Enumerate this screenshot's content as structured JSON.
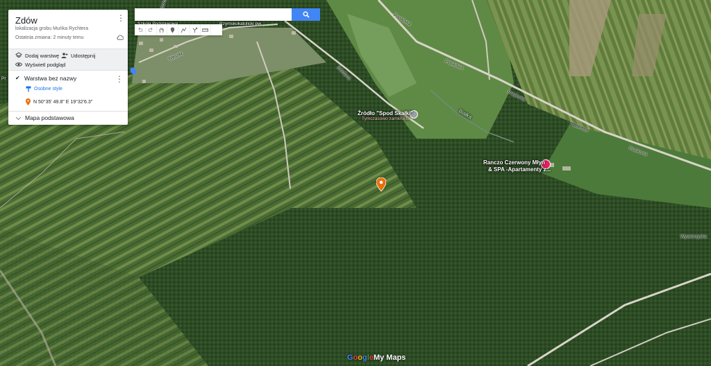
{
  "panel": {
    "title": "Zdów",
    "description": "lokalizacja grobu Muńka Rychtera",
    "last_change": "Ostatnia zmiana: 2 minuty temu",
    "add_layer": "Dodaj warstwę",
    "share": "Udostępnij",
    "preview": "Wyświetl podgląd",
    "layer_name": "Warstwa bez nazwy",
    "layer_style": "Osobne style",
    "marker_coord": "N 50°35' 49.8\" E 19°32'6.3\"",
    "basemap": "Mapa podstawowa"
  },
  "search": {
    "placeholder": "",
    "value": ""
  },
  "toolbar": {
    "tools": [
      "undo-icon",
      "redo-icon",
      "hand-icon",
      "marker-icon",
      "draw-line-icon",
      "route-icon",
      "ruler-icon"
    ]
  },
  "map": {
    "road_labels": [
      "Piaskowa",
      "Piaskowa",
      "Piaskowa",
      "Piaskowa",
      "Źródlana",
      "Wesoła",
      "Topolowa",
      "Wywierzyska"
    ],
    "river_label": "Białka",
    "poi1_title": "Źródło \"Spod Skałki\"",
    "poi1_sub": "Tymczasowo zamknięte",
    "poi2_line1": "Ranczo Czerwony Młyn",
    "poi2_line2": "& SPA -Apartamenty z...",
    "village_label": "Szkoła Podstawowa",
    "church_label": "Rzymskokatolicki pw.",
    "left_edge_label": "Pr",
    "attribution": "Google My Maps"
  },
  "colors": {
    "accent": "#4285f4",
    "marker": "#e8710a",
    "poi_pink": "#e91e63"
  }
}
